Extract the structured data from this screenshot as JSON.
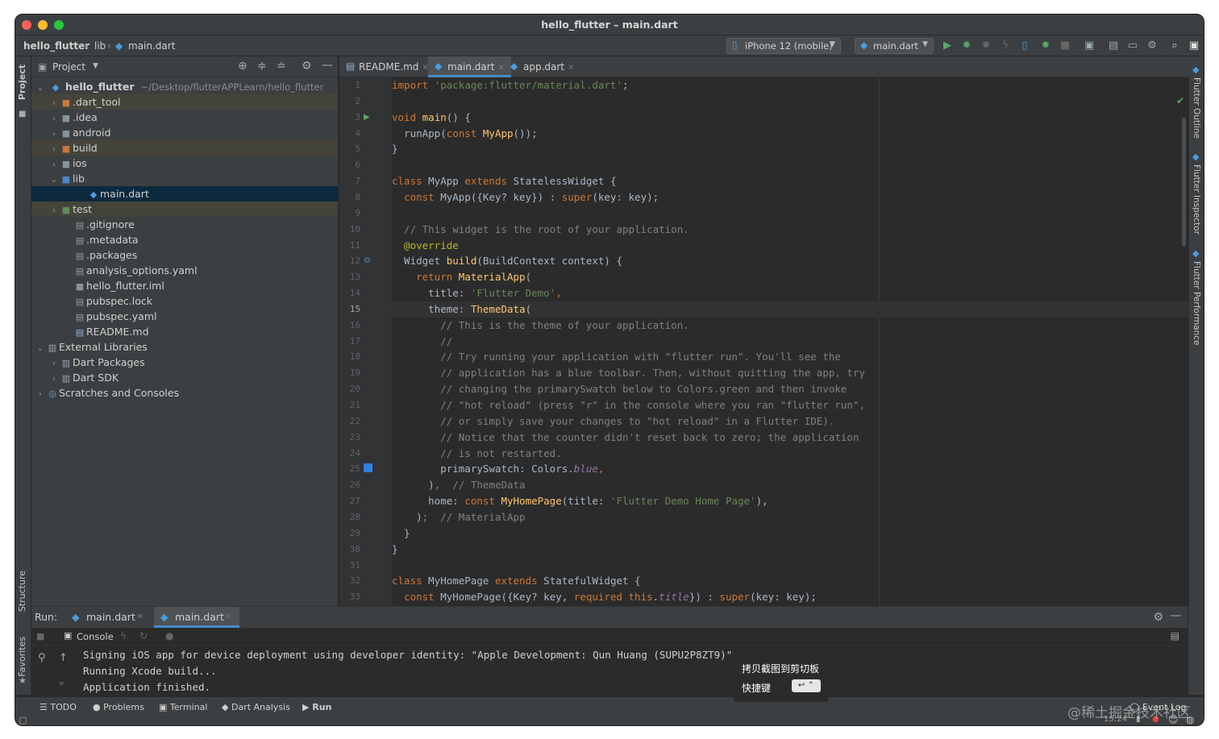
{
  "window": {
    "title": "hello_flutter – main.dart"
  },
  "breadcrumb": [
    "hello_flutter",
    "lib",
    "main.dart"
  ],
  "toolbar": {
    "device": "iPhone 12 (mobile)",
    "config": "main.dart"
  },
  "left_strip": {
    "project": "Project",
    "structure": "Structure",
    "favorites": "Favorites"
  },
  "right_strip": {
    "outline": "Flutter Outline",
    "inspector": "Flutter Inspector",
    "performance": "Flutter Performance"
  },
  "project": {
    "title": "Project",
    "root_name": "hello_flutter",
    "root_path": "~/Desktop/flutterAPPLearn/hello_flutter",
    "items": [
      {
        "label": ".dart_tool",
        "arrow": "›",
        "icon": "■",
        "color": "#c7783a",
        "indent": 1,
        "hl": true
      },
      {
        "label": ".idea",
        "arrow": "›",
        "icon": "■",
        "color": "#87939a",
        "indent": 1
      },
      {
        "label": "android",
        "arrow": "›",
        "icon": "■",
        "color": "#87939a",
        "indent": 1
      },
      {
        "label": "build",
        "arrow": "›",
        "icon": "■",
        "color": "#c7783a",
        "indent": 1,
        "hl": true
      },
      {
        "label": "ios",
        "arrow": "›",
        "icon": "■",
        "color": "#87939a",
        "indent": 1
      },
      {
        "label": "lib",
        "arrow": "⌄",
        "icon": "■",
        "color": "#4a88c7",
        "indent": 1
      },
      {
        "label": "main.dart",
        "arrow": "",
        "icon": "◆",
        "color": "#4a9de0",
        "indent": 3,
        "sel": true
      },
      {
        "label": "test",
        "arrow": "›",
        "icon": "■",
        "color": "#5f8d5a",
        "indent": 1,
        "hl": true
      },
      {
        "label": ".gitignore",
        "arrow": "",
        "icon": "▤",
        "color": "#9a9a9a",
        "indent": 2
      },
      {
        "label": ".metadata",
        "arrow": "",
        "icon": "▤",
        "color": "#9a9a9a",
        "indent": 2
      },
      {
        "label": ".packages",
        "arrow": "",
        "icon": "▤",
        "color": "#9a9a9a",
        "indent": 2
      },
      {
        "label": "analysis_options.yaml",
        "arrow": "",
        "icon": "▤",
        "color": "#9a9a9a",
        "indent": 2
      },
      {
        "label": "hello_flutter.iml",
        "arrow": "",
        "icon": "■",
        "color": "#87939a",
        "indent": 2
      },
      {
        "label": "pubspec.lock",
        "arrow": "",
        "icon": "▤",
        "color": "#9a9a9a",
        "indent": 2
      },
      {
        "label": "pubspec.yaml",
        "arrow": "",
        "icon": "▤",
        "color": "#9a9a9a",
        "indent": 2
      },
      {
        "label": "README.md",
        "arrow": "",
        "icon": "▤",
        "color": "#8fb0d8",
        "indent": 2
      },
      {
        "label": "External Libraries",
        "arrow": "⌄",
        "icon": "▥",
        "color": "#9aa7b0",
        "indent": 0
      },
      {
        "label": "Dart Packages",
        "arrow": "›",
        "icon": "▥",
        "color": "#9aa7b0",
        "indent": 1
      },
      {
        "label": "Dart SDK",
        "arrow": "›",
        "icon": "▥",
        "color": "#9aa7b0",
        "indent": 1
      },
      {
        "label": "Scratches and Consoles",
        "arrow": "›",
        "icon": "◎",
        "color": "#6aa3d8",
        "indent": 0
      }
    ]
  },
  "editor": {
    "tabs": [
      {
        "label": "README.md",
        "icon": "▤",
        "active": false
      },
      {
        "label": "main.dart",
        "icon": "◆",
        "active": true
      },
      {
        "label": "app.dart",
        "icon": "◆",
        "active": false
      }
    ],
    "current_line": 15,
    "lines": [
      [
        [
          "kw",
          "import "
        ],
        [
          "str",
          "'package:flutter/material.dart'"
        ],
        [
          "",
          "; "
        ]
      ],
      [],
      [
        [
          "kw",
          "void "
        ],
        [
          "fn",
          "main"
        ],
        [
          "",
          "() {"
        ]
      ],
      [
        [
          "",
          "  runApp("
        ],
        [
          "kw",
          "const "
        ],
        [
          "fn",
          "MyApp"
        ],
        [
          "",
          "());"
        ]
      ],
      [
        [
          "",
          "}"
        ]
      ],
      [],
      [
        [
          "kw",
          "class "
        ],
        [
          "",
          "MyApp "
        ],
        [
          "kw",
          "extends "
        ],
        [
          "",
          "StatelessWidget {"
        ]
      ],
      [
        [
          "",
          "  "
        ],
        [
          "kw",
          "const "
        ],
        [
          "",
          "MyApp({Key? key}) : "
        ],
        [
          "kw",
          "super"
        ],
        [
          "",
          "(key: key);"
        ]
      ],
      [],
      [
        [
          "cmt",
          "  // This widget is the root of your application."
        ]
      ],
      [
        [
          "ann",
          "  @override"
        ]
      ],
      [
        [
          "",
          "  Widget "
        ],
        [
          "fn",
          "build"
        ],
        [
          "",
          "(BuildContext context) {"
        ]
      ],
      [
        [
          "",
          "    "
        ],
        [
          "kw",
          "return "
        ],
        [
          "fn",
          "MaterialApp"
        ],
        [
          "",
          "("
        ]
      ],
      [
        [
          "",
          "      title: "
        ],
        [
          "str",
          "'Flutter Demo'"
        ],
        [
          "kw",
          ","
        ]
      ],
      [
        [
          "",
          "      theme: "
        ],
        [
          "fn",
          "ThemeData"
        ],
        [
          "",
          "("
        ]
      ],
      [
        [
          "cmt",
          "        // This is the theme of your application."
        ]
      ],
      [
        [
          "cmt",
          "        //"
        ]
      ],
      [
        [
          "cmt",
          "        // Try running your application with \"flutter run\". You'll see the"
        ]
      ],
      [
        [
          "cmt",
          "        // application has a blue toolbar. Then, without quitting the app, try"
        ]
      ],
      [
        [
          "cmt",
          "        // changing the primarySwatch below to Colors.green and then invoke"
        ]
      ],
      [
        [
          "cmt",
          "        // \"hot reload\" (press \"r\" in the console where you ran \"flutter run\","
        ]
      ],
      [
        [
          "cmt",
          "        // or simply save your changes to \"hot reload\" in a Flutter IDE)."
        ]
      ],
      [
        [
          "cmt",
          "        // Notice that the counter didn't reset back to zero; the application"
        ]
      ],
      [
        [
          "cmt",
          "        // is not restarted."
        ]
      ],
      [
        [
          "",
          "        primarySwatch: Colors."
        ],
        [
          "prop",
          "blue"
        ],
        [
          "kw",
          ","
        ]
      ],
      [
        [
          "",
          "      )"
        ],
        [
          "kw",
          ", "
        ],
        [
          "cmt",
          " // ThemeData"
        ]
      ],
      [
        [
          "",
          "      home: "
        ],
        [
          "kw",
          "const "
        ],
        [
          "fn",
          "MyHomePage"
        ],
        [
          "",
          "(title: "
        ],
        [
          "str",
          "'Flutter Demo Home Page'"
        ],
        [
          "",
          "),"
        ]
      ],
      [
        [
          "",
          "    )"
        ],
        [
          "kw",
          ";"
        ],
        [
          "cmt",
          "  // MaterialApp"
        ]
      ],
      [
        [
          "",
          "  }"
        ]
      ],
      [
        [
          "",
          "}"
        ]
      ],
      [],
      [
        [
          "kw",
          "class "
        ],
        [
          "",
          "MyHomePage "
        ],
        [
          "kw",
          "extends "
        ],
        [
          "",
          "StatefulWidget {"
        ]
      ],
      [
        [
          "",
          "  "
        ],
        [
          "kw",
          "const "
        ],
        [
          "",
          "MyHomePage({Key? key, "
        ],
        [
          "kw",
          "required "
        ],
        [
          "kw",
          "this"
        ],
        [
          "",
          "."
        ],
        [
          "prop",
          "title"
        ],
        [
          "",
          "}) : "
        ],
        [
          "kw",
          "super"
        ],
        [
          "",
          "(key: key);"
        ]
      ]
    ]
  },
  "run": {
    "label": "Run:",
    "tabs": [
      "main.dart",
      "main.dart"
    ],
    "console_label": "Console",
    "output": [
      "Signing iOS app for device deployment using developer identity: \"Apple Development: Qun Huang (SUPU2P8ZT9)\"",
      "Running Xcode build...",
      "Application finished."
    ]
  },
  "bottom_tools": [
    "TODO",
    "Problems",
    "Terminal",
    "Dart Analysis",
    "Run"
  ],
  "status": {
    "event_log": "Event Log",
    "time": "15:24"
  },
  "toast": {
    "line1": "拷贝截图到剪切板",
    "line2": "快捷键"
  },
  "watermark": "@稀土掘金技术社区"
}
